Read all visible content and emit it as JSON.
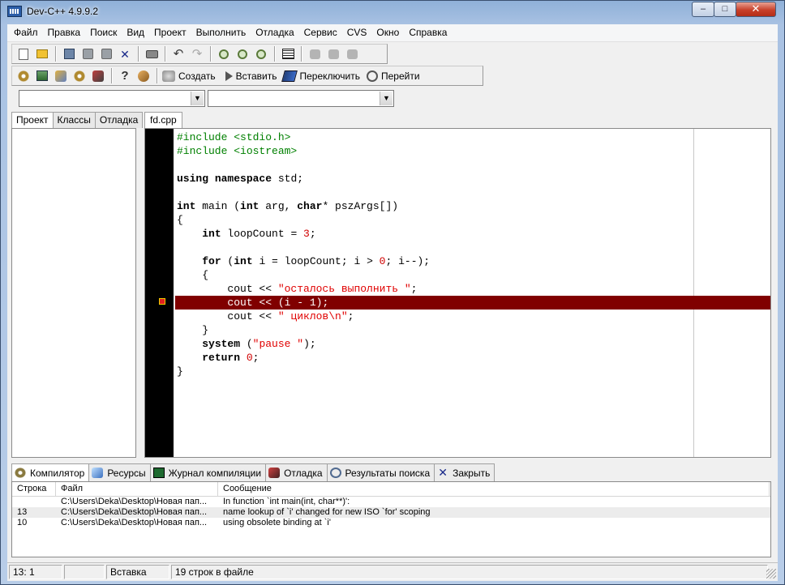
{
  "window": {
    "title": "Dev-C++ 4.9.9.2",
    "min_label": "–",
    "max_label": "□",
    "close_label": "✕"
  },
  "menu": [
    "Файл",
    "Правка",
    "Поиск",
    "Вид",
    "Проект",
    "Выполнить",
    "Отладка",
    "Сервис",
    "CVS",
    "Окно",
    "Справка"
  ],
  "toolbar2": {
    "create_label": "Создать",
    "insert_label": "Вставить",
    "toggle_label": "Переключить",
    "goto_label": "Перейти"
  },
  "combos": {
    "class_value": "",
    "member_value": ""
  },
  "left_tabs": [
    "Проект",
    "Классы",
    "Отладка"
  ],
  "editor": {
    "file_tab": "fd.cpp",
    "lines": [
      "#include <stdio.h>",
      "#include <iostream>",
      "",
      "using namespace std;",
      "",
      "int main (int arg, char* pszArgs[])",
      "{",
      "    int loopCount = 3;",
      "",
      "    for (int i = loopCount; i > 0; i--);",
      "    {",
      "        cout << \"осталось выполнить \";",
      "        cout << (i - 1);",
      "        cout << \" циклов\\n\";",
      "    }",
      "    system (\"pause \");",
      "    return 0;",
      "}"
    ],
    "error_line_index": 12
  },
  "bottom_tabs": [
    {
      "label": "Компилятор",
      "icon": "compiler-icon"
    },
    {
      "label": "Ресурсы",
      "icon": "resources-icon"
    },
    {
      "label": "Журнал компиляции",
      "icon": "compile-log-icon"
    },
    {
      "label": "Отладка",
      "icon": "debug-icon"
    },
    {
      "label": "Результаты поиска",
      "icon": "find-results-icon"
    },
    {
      "label": "Закрыть",
      "icon": "close-icon"
    }
  ],
  "messages": {
    "columns": [
      "Строка",
      "Файл",
      "Сообщение"
    ],
    "rows": [
      {
        "line": "",
        "file": "C:\\Users\\Deka\\Desktop\\Новая пап...",
        "message": "In function `int main(int, char**)':"
      },
      {
        "line": "13",
        "file": "C:\\Users\\Deka\\Desktop\\Новая пап...",
        "message": "name lookup of `i' changed for new ISO `for' scoping"
      },
      {
        "line": "10",
        "file": "C:\\Users\\Deka\\Desktop\\Новая пап...",
        "message": "  using obsolete binding at `i'"
      }
    ]
  },
  "status": {
    "position": "13: 1",
    "modified": "",
    "mode": "Вставка",
    "info": "19 строк в файле"
  }
}
